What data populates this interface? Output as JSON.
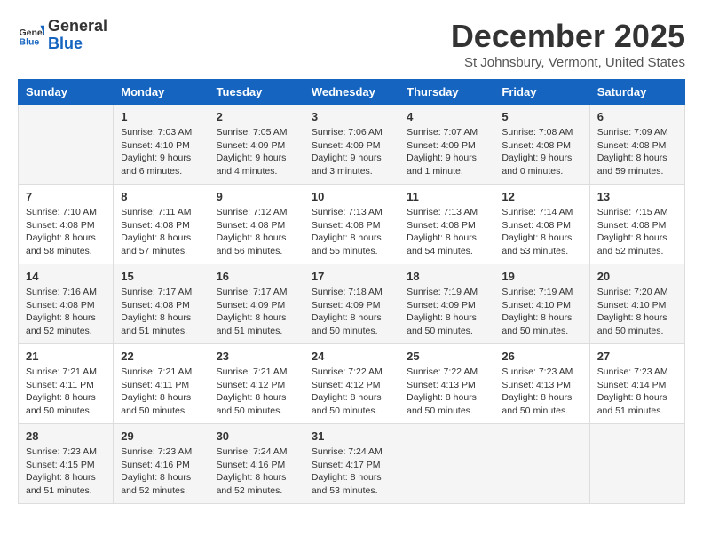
{
  "logo": {
    "general": "General",
    "blue": "Blue"
  },
  "header": {
    "month": "December 2025",
    "location": "St Johnsbury, Vermont, United States"
  },
  "weekdays": [
    "Sunday",
    "Monday",
    "Tuesday",
    "Wednesday",
    "Thursday",
    "Friday",
    "Saturday"
  ],
  "weeks": [
    [
      {
        "day": "",
        "sunrise": "",
        "sunset": "",
        "daylight": ""
      },
      {
        "day": "1",
        "sunrise": "Sunrise: 7:03 AM",
        "sunset": "Sunset: 4:10 PM",
        "daylight": "Daylight: 9 hours and 6 minutes."
      },
      {
        "day": "2",
        "sunrise": "Sunrise: 7:05 AM",
        "sunset": "Sunset: 4:09 PM",
        "daylight": "Daylight: 9 hours and 4 minutes."
      },
      {
        "day": "3",
        "sunrise": "Sunrise: 7:06 AM",
        "sunset": "Sunset: 4:09 PM",
        "daylight": "Daylight: 9 hours and 3 minutes."
      },
      {
        "day": "4",
        "sunrise": "Sunrise: 7:07 AM",
        "sunset": "Sunset: 4:09 PM",
        "daylight": "Daylight: 9 hours and 1 minute."
      },
      {
        "day": "5",
        "sunrise": "Sunrise: 7:08 AM",
        "sunset": "Sunset: 4:08 PM",
        "daylight": "Daylight: 9 hours and 0 minutes."
      },
      {
        "day": "6",
        "sunrise": "Sunrise: 7:09 AM",
        "sunset": "Sunset: 4:08 PM",
        "daylight": "Daylight: 8 hours and 59 minutes."
      }
    ],
    [
      {
        "day": "7",
        "sunrise": "Sunrise: 7:10 AM",
        "sunset": "Sunset: 4:08 PM",
        "daylight": "Daylight: 8 hours and 58 minutes."
      },
      {
        "day": "8",
        "sunrise": "Sunrise: 7:11 AM",
        "sunset": "Sunset: 4:08 PM",
        "daylight": "Daylight: 8 hours and 57 minutes."
      },
      {
        "day": "9",
        "sunrise": "Sunrise: 7:12 AM",
        "sunset": "Sunset: 4:08 PM",
        "daylight": "Daylight: 8 hours and 56 minutes."
      },
      {
        "day": "10",
        "sunrise": "Sunrise: 7:13 AM",
        "sunset": "Sunset: 4:08 PM",
        "daylight": "Daylight: 8 hours and 55 minutes."
      },
      {
        "day": "11",
        "sunrise": "Sunrise: 7:13 AM",
        "sunset": "Sunset: 4:08 PM",
        "daylight": "Daylight: 8 hours and 54 minutes."
      },
      {
        "day": "12",
        "sunrise": "Sunrise: 7:14 AM",
        "sunset": "Sunset: 4:08 PM",
        "daylight": "Daylight: 8 hours and 53 minutes."
      },
      {
        "day": "13",
        "sunrise": "Sunrise: 7:15 AM",
        "sunset": "Sunset: 4:08 PM",
        "daylight": "Daylight: 8 hours and 52 minutes."
      }
    ],
    [
      {
        "day": "14",
        "sunrise": "Sunrise: 7:16 AM",
        "sunset": "Sunset: 4:08 PM",
        "daylight": "Daylight: 8 hours and 52 minutes."
      },
      {
        "day": "15",
        "sunrise": "Sunrise: 7:17 AM",
        "sunset": "Sunset: 4:08 PM",
        "daylight": "Daylight: 8 hours and 51 minutes."
      },
      {
        "day": "16",
        "sunrise": "Sunrise: 7:17 AM",
        "sunset": "Sunset: 4:09 PM",
        "daylight": "Daylight: 8 hours and 51 minutes."
      },
      {
        "day": "17",
        "sunrise": "Sunrise: 7:18 AM",
        "sunset": "Sunset: 4:09 PM",
        "daylight": "Daylight: 8 hours and 50 minutes."
      },
      {
        "day": "18",
        "sunrise": "Sunrise: 7:19 AM",
        "sunset": "Sunset: 4:09 PM",
        "daylight": "Daylight: 8 hours and 50 minutes."
      },
      {
        "day": "19",
        "sunrise": "Sunrise: 7:19 AM",
        "sunset": "Sunset: 4:10 PM",
        "daylight": "Daylight: 8 hours and 50 minutes."
      },
      {
        "day": "20",
        "sunrise": "Sunrise: 7:20 AM",
        "sunset": "Sunset: 4:10 PM",
        "daylight": "Daylight: 8 hours and 50 minutes."
      }
    ],
    [
      {
        "day": "21",
        "sunrise": "Sunrise: 7:21 AM",
        "sunset": "Sunset: 4:11 PM",
        "daylight": "Daylight: 8 hours and 50 minutes."
      },
      {
        "day": "22",
        "sunrise": "Sunrise: 7:21 AM",
        "sunset": "Sunset: 4:11 PM",
        "daylight": "Daylight: 8 hours and 50 minutes."
      },
      {
        "day": "23",
        "sunrise": "Sunrise: 7:21 AM",
        "sunset": "Sunset: 4:12 PM",
        "daylight": "Daylight: 8 hours and 50 minutes."
      },
      {
        "day": "24",
        "sunrise": "Sunrise: 7:22 AM",
        "sunset": "Sunset: 4:12 PM",
        "daylight": "Daylight: 8 hours and 50 minutes."
      },
      {
        "day": "25",
        "sunrise": "Sunrise: 7:22 AM",
        "sunset": "Sunset: 4:13 PM",
        "daylight": "Daylight: 8 hours and 50 minutes."
      },
      {
        "day": "26",
        "sunrise": "Sunrise: 7:23 AM",
        "sunset": "Sunset: 4:13 PM",
        "daylight": "Daylight: 8 hours and 50 minutes."
      },
      {
        "day": "27",
        "sunrise": "Sunrise: 7:23 AM",
        "sunset": "Sunset: 4:14 PM",
        "daylight": "Daylight: 8 hours and 51 minutes."
      }
    ],
    [
      {
        "day": "28",
        "sunrise": "Sunrise: 7:23 AM",
        "sunset": "Sunset: 4:15 PM",
        "daylight": "Daylight: 8 hours and 51 minutes."
      },
      {
        "day": "29",
        "sunrise": "Sunrise: 7:23 AM",
        "sunset": "Sunset: 4:16 PM",
        "daylight": "Daylight: 8 hours and 52 minutes."
      },
      {
        "day": "30",
        "sunrise": "Sunrise: 7:24 AM",
        "sunset": "Sunset: 4:16 PM",
        "daylight": "Daylight: 8 hours and 52 minutes."
      },
      {
        "day": "31",
        "sunrise": "Sunrise: 7:24 AM",
        "sunset": "Sunset: 4:17 PM",
        "daylight": "Daylight: 8 hours and 53 minutes."
      },
      {
        "day": "",
        "sunrise": "",
        "sunset": "",
        "daylight": ""
      },
      {
        "day": "",
        "sunrise": "",
        "sunset": "",
        "daylight": ""
      },
      {
        "day": "",
        "sunrise": "",
        "sunset": "",
        "daylight": ""
      }
    ]
  ]
}
